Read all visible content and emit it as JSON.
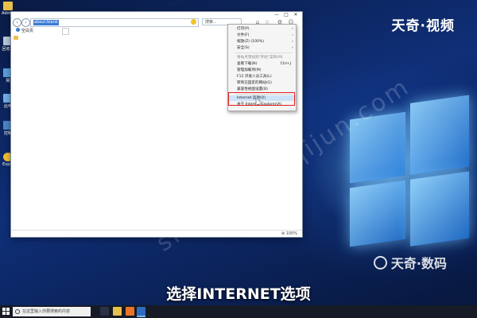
{
  "brand": {
    "top": "天奇·视频",
    "bottom": "天奇·数码",
    "watermark": "shuma.tianqijun.com"
  },
  "subtitle": "选择INTERNET选项",
  "desktop_icons": [
    {
      "label": "Admin"
    },
    {
      "label": "回收站"
    },
    {
      "label": "网"
    },
    {
      "label": "此电"
    },
    {
      "label": "控制"
    },
    {
      "label": "Explo"
    }
  ],
  "browser": {
    "address": "about:blank",
    "search_placeholder": "搜索...",
    "tab_label": "空白页",
    "zoom": "100%",
    "window_controls": {
      "minimize": "—",
      "maximize": "□",
      "close": "✕"
    },
    "tools_menu": {
      "items": [
        {
          "label": "打印(P)",
          "shortcut": "",
          "arrow": true,
          "disabled": false
        },
        {
          "label": "文件(F)",
          "shortcut": "",
          "arrow": true,
          "disabled": false
        },
        {
          "label": "缩放(Z) (100%)",
          "shortcut": "",
          "arrow": true,
          "disabled": false
        },
        {
          "label": "安全(S)",
          "shortcut": "",
          "arrow": true,
          "disabled": false
        },
        {
          "label": "将站点添加到\"开始\"菜单(M)",
          "shortcut": "",
          "arrow": false,
          "disabled": true
        },
        {
          "label": "查看下载(N)",
          "shortcut": "Ctrl+J",
          "arrow": false,
          "disabled": false
        },
        {
          "label": "管理加载项(M)",
          "shortcut": "",
          "arrow": false,
          "disabled": false
        },
        {
          "label": "F12 开发人员工具(L)",
          "shortcut": "",
          "arrow": false,
          "disabled": false
        },
        {
          "label": "转到已固定的网站(G)",
          "shortcut": "",
          "arrow": false,
          "disabled": false
        },
        {
          "label": "兼容性视图设置(B)",
          "shortcut": "",
          "arrow": false,
          "disabled": false
        },
        {
          "label": "Internet 选项(O)",
          "shortcut": "",
          "arrow": false,
          "disabled": false,
          "highlighted": true
        },
        {
          "label": "关于 Internet Explorer(A)",
          "shortcut": "",
          "arrow": false,
          "disabled": false
        }
      ]
    }
  },
  "taskbar": {
    "search_placeholder": "在这里输入你要搜索的内容"
  },
  "colors": {
    "accent": "#3a7bd5",
    "highlight_box": "#e02020",
    "taskbar": "#161b26"
  }
}
